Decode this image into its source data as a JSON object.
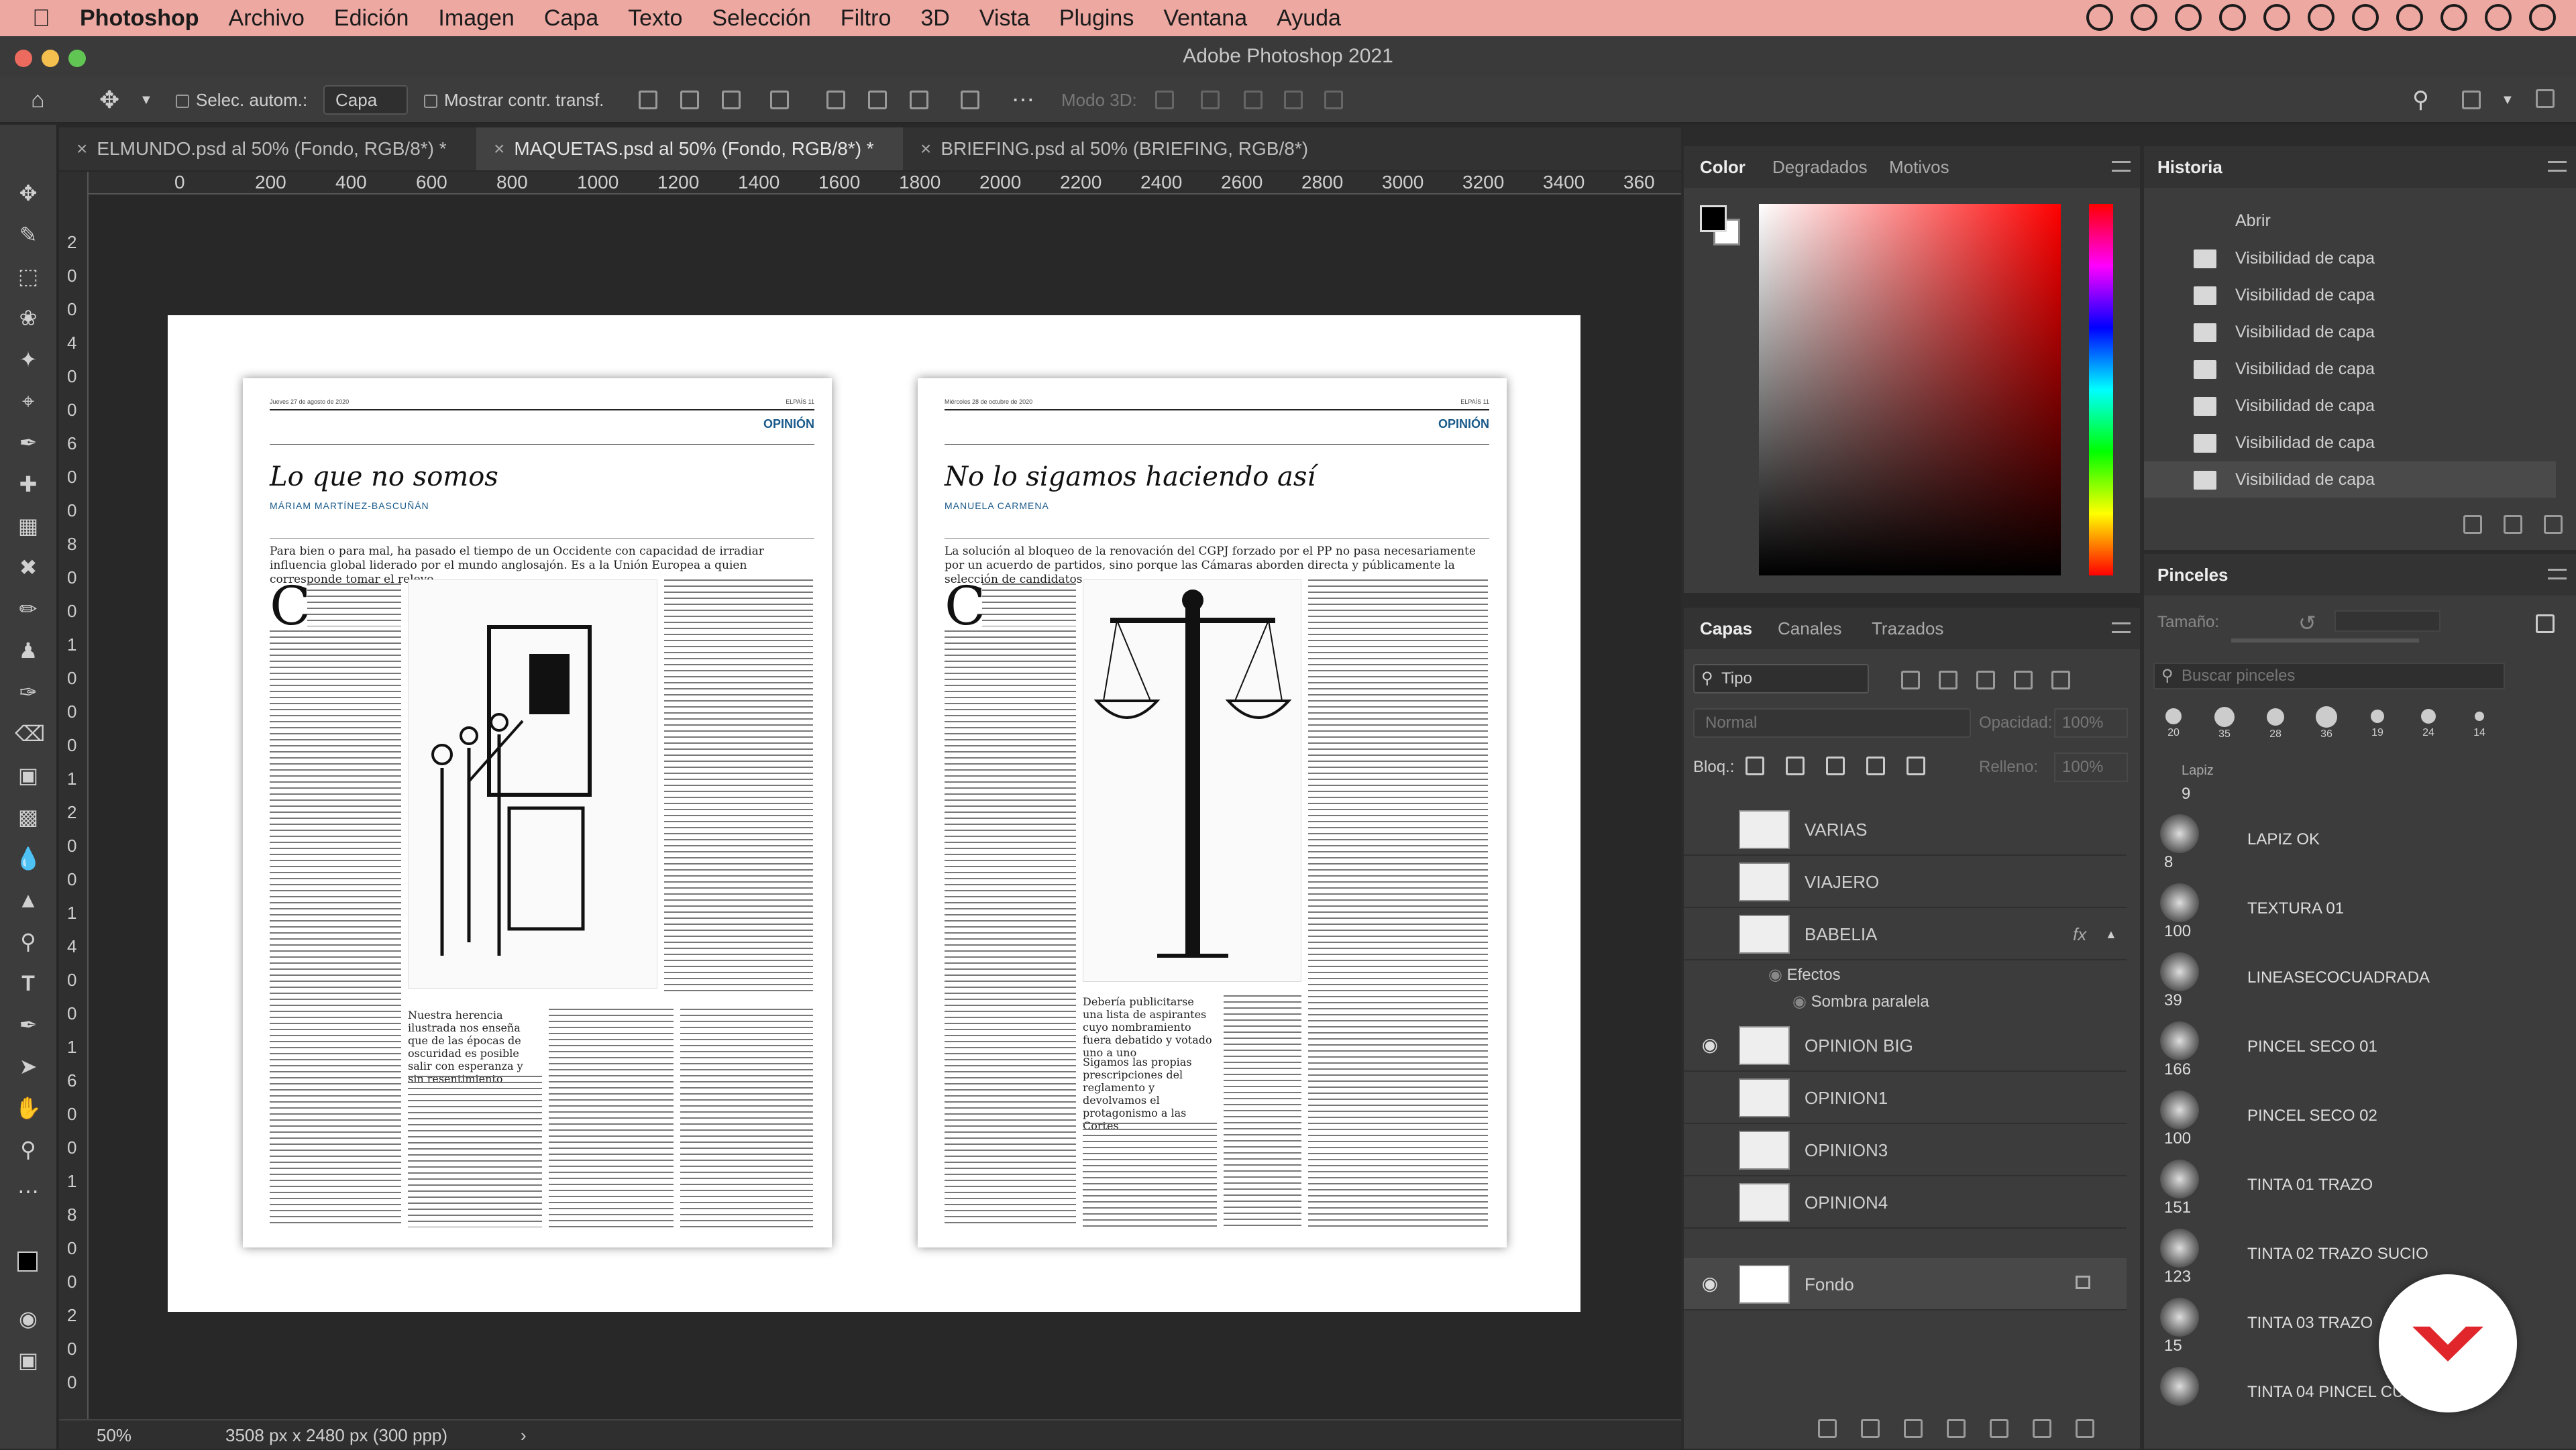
{
  "menubar": {
    "app": "Photoshop",
    "items": [
      "Archivo",
      "Edición",
      "Imagen",
      "Capa",
      "Texto",
      "Selección",
      "Filtro",
      "3D",
      "Vista",
      "Plugins",
      "Ventana",
      "Ayuda"
    ]
  },
  "window": {
    "title": "Adobe Photoshop 2021"
  },
  "options": {
    "auto_select_label": "Selec. autom.:",
    "auto_select_value": "Capa",
    "show_transform_label": "Mostrar contr. transf.",
    "mode3d_label": "Modo 3D:"
  },
  "tabs": [
    {
      "label": "ELMUNDO.psd al 50% (Fondo, RGB/8*) *"
    },
    {
      "label": "MAQUETAS.psd al 50% (Fondo, RGB/8*) *"
    },
    {
      "label": "BRIEFING.psd al 50% (BRIEFING, RGB/8*)"
    }
  ],
  "ruler_h": [
    "0",
    "200",
    "400",
    "600",
    "800",
    "1000",
    "1200",
    "1400",
    "1600",
    "1800",
    "2000",
    "2200",
    "2400",
    "2600",
    "2800",
    "3000",
    "3200",
    "3400",
    "360"
  ],
  "ruler_v": [
    "2",
    "0",
    "0",
    "4",
    "0",
    "0",
    "6",
    "0",
    "0",
    "8",
    "0",
    "0",
    "1",
    "0",
    "0",
    "0",
    "1",
    "2",
    "0",
    "0",
    "1",
    "4",
    "0",
    "0",
    "1",
    "6",
    "0",
    "0",
    "1",
    "8",
    "0",
    "0",
    "2",
    "0",
    "0"
  ],
  "document": {
    "page1": {
      "date": "Jueves 27 de agosto de 2020",
      "num": "ELPAÍS 11",
      "section": "OPINIÓN",
      "title": "Lo que no somos",
      "author": "MÁRIAM MARTÍNEZ-BASCUÑÁN",
      "lead": "Para bien o para mal, ha pasado el tiempo de un Occidente con capacidad de irradiar influencia global liderado por el mundo anglosajón. Es a la Unión Europea a quien corresponde tomar el relevo",
      "dropcap": "C",
      "caption": "Nuestra herencia ilustrada nos enseña que de las épocas de oscuridad es posible salir con esperanza y sin resentimiento"
    },
    "page2": {
      "date": "Miércoles 28 de octubre de 2020",
      "num": "ELPAÍS 11",
      "section": "OPINIÓN",
      "title": "No lo sigamos haciendo así",
      "author": "MANUELA CARMENA",
      "lead": "La solución al bloqueo de la renovación del CGPJ forzado por el PP no pasa necesariamente por un acuerdo de partidos, sino porque las Cámaras aborden directa y públicamente la selección de candidatos",
      "dropcap": "C",
      "caption1": "Debería publicitarse una lista de aspirantes cuyo nombramiento fuera debatido y votado uno a uno",
      "caption2": "Sigamos las propias prescripciones del reglamento y devolvamos el protagonismo a las Cortes"
    }
  },
  "status": {
    "zoom": "50%",
    "size": "3508 px x 2480 px (300 ppp)"
  },
  "color_panel": {
    "tabs": [
      "Color",
      "Degradados",
      "Motivos"
    ]
  },
  "history_panel": {
    "title": "Historia",
    "items": [
      "Abrir",
      "Visibilidad de capa",
      "Visibilidad de capa",
      "Visibilidad de capa",
      "Visibilidad de capa",
      "Visibilidad de capa",
      "Visibilidad de capa",
      "Visibilidad de capa"
    ]
  },
  "brushes_panel": {
    "title": "Pinceles",
    "size_label": "Tamaño:",
    "search_placeholder": "Buscar pinceles",
    "presets": [
      "20",
      "35",
      "28",
      "36",
      "19",
      "24",
      "14"
    ],
    "partial_label": "Lapiz",
    "partial_size": "9",
    "items": [
      {
        "size": "8",
        "name": "LAPIZ OK"
      },
      {
        "size": "100",
        "name": "TEXTURA 01"
      },
      {
        "size": "39",
        "name": "LINEASECOCUADRADA"
      },
      {
        "size": "166",
        "name": "PINCEL SECO 01"
      },
      {
        "size": "100",
        "name": "PINCEL SECO 02"
      },
      {
        "size": "151",
        "name": "TINTA 01 TRAZO"
      },
      {
        "size": "123",
        "name": "TINTA 02 TRAZO SUCIO"
      },
      {
        "size": "15",
        "name": "TINTA 03 TRAZO"
      },
      {
        "size": "",
        "name": "TINTA 04 PINCEL CUADRADO"
      }
    ]
  },
  "layers_panel": {
    "tabs": [
      "Capas",
      "Canales",
      "Trazados"
    ],
    "filter": "Tipo",
    "blend_mode": "Normal",
    "opacity_label": "Opacidad:",
    "opacity_value": "100%",
    "lock_label": "Bloq.:",
    "fill_label": "Relleno:",
    "fill_value": "100%",
    "layers": [
      {
        "name": "VARIAS",
        "visible": false
      },
      {
        "name": "VIAJERO",
        "visible": false
      },
      {
        "name": "BABELIA",
        "visible": false,
        "fx": "fx"
      },
      {
        "name": "OPINION BIG",
        "visible": true
      },
      {
        "name": "OPINION1",
        "visible": false
      },
      {
        "name": "OPINION3",
        "visible": false
      },
      {
        "name": "OPINION4",
        "visible": false
      },
      {
        "name": "Fondo",
        "visible": true
      }
    ],
    "effects_label": "Efectos",
    "effect_name": "Sombra paralela"
  },
  "colors": {
    "menubar": "#eda8a2",
    "section_blue": "#1a5a8a",
    "badge_red": "#e0262b"
  }
}
